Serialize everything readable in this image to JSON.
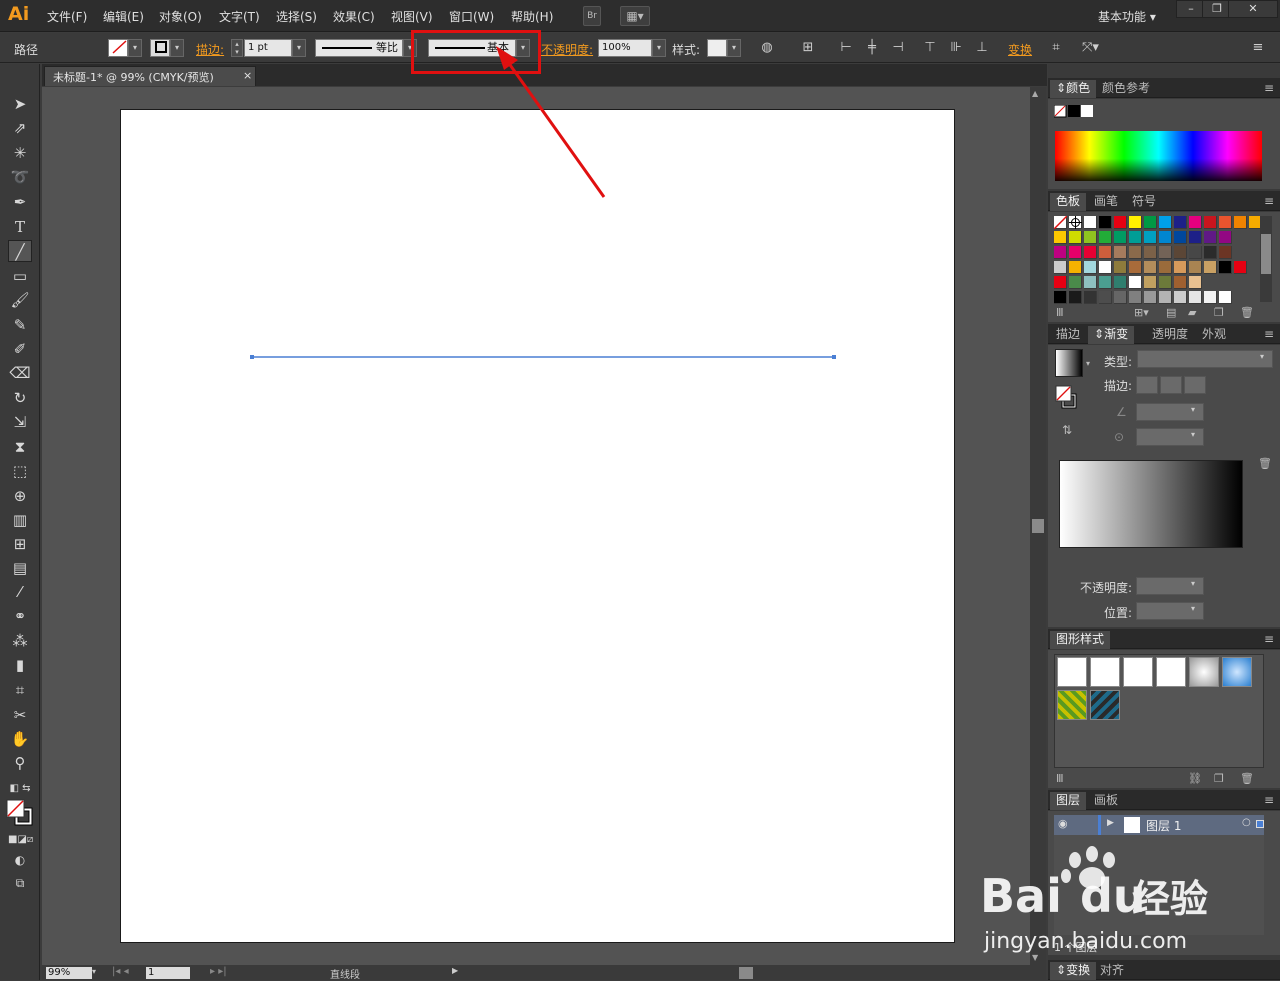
{
  "app": {
    "logo": "Ai"
  },
  "menu": {
    "items": [
      "文件(F)",
      "编辑(E)",
      "对象(O)",
      "文字(T)",
      "选择(S)",
      "效果(C)",
      "视图(V)",
      "窗口(W)",
      "帮助(H)"
    ],
    "bridge": "Br",
    "workspace": "基本功能"
  },
  "control": {
    "selection_type": "路径",
    "stroke_label": "描边",
    "stroke_weight": "1 pt",
    "profile_label": "等比",
    "brush_label": "基本",
    "opacity_label": "不透明度",
    "opacity_value": "100%",
    "style_label": "样式",
    "transform_label": "变换"
  },
  "document": {
    "tab_title": "未标题-1* @ 99% (CMYK/预览)"
  },
  "panels": {
    "color": {
      "tabs": [
        "颜色",
        "颜色参考"
      ]
    },
    "swatches": {
      "tabs": [
        "色板",
        "画笔",
        "符号"
      ]
    },
    "gradient": {
      "tabs": [
        "描边",
        "渐变",
        "透明度",
        "外观"
      ],
      "type_label": "类型",
      "stroke_label": "描边",
      "opacity_label": "不透明度",
      "position_label": "位置"
    },
    "graphic_styles": {
      "title": "图形样式"
    },
    "layers": {
      "tabs": [
        "图层",
        "画板"
      ],
      "layer_name": "图层 1",
      "count": "1 个图层"
    },
    "bottom": {
      "tabs": [
        "变换",
        "对齐"
      ]
    }
  },
  "status": {
    "zoom": "99%",
    "artboard_num": "1",
    "tool_name": "直线段"
  },
  "watermark": {
    "text": "Bai",
    "text2": "du",
    "brand": "经验",
    "url": "jingyan.baidu.com"
  },
  "colors": {
    "accent": "#f29a1f",
    "line": "#4a7fd4",
    "highlight": "#e01010"
  }
}
